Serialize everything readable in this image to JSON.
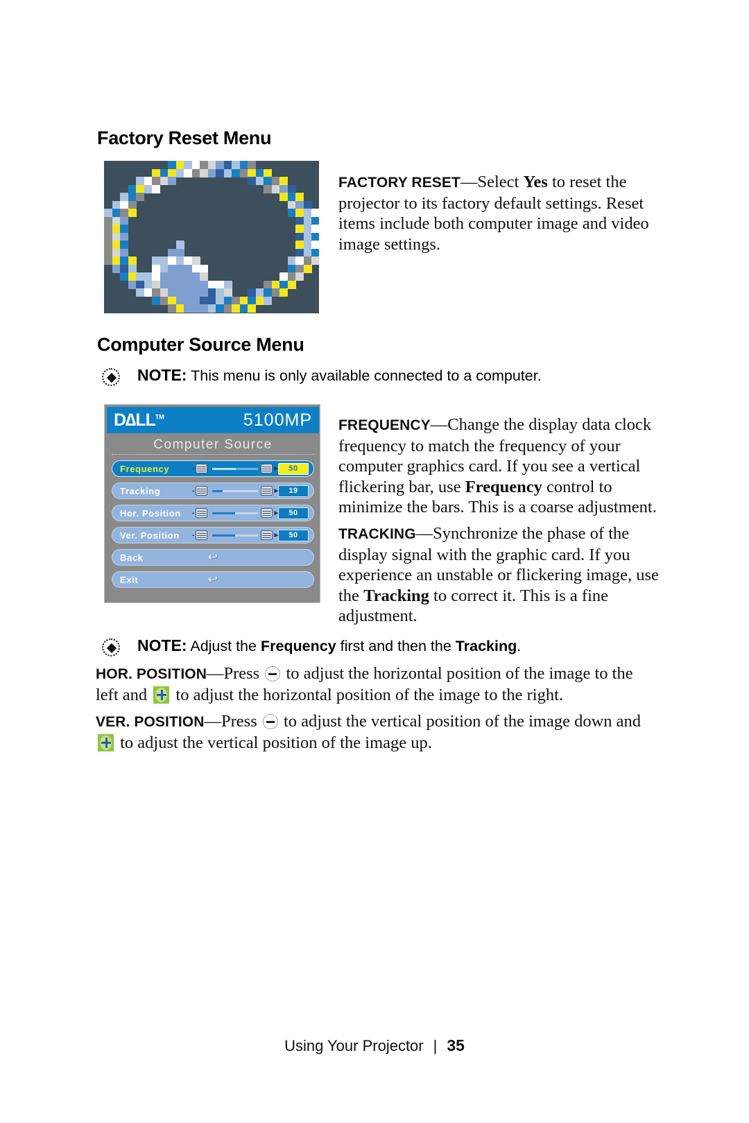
{
  "page": {
    "footer_section": "Using Your Projector",
    "footer_separator": "|",
    "page_number": "35"
  },
  "factory_reset_section": {
    "heading": "Factory Reset Menu",
    "paragraph": {
      "term": "FACTORY RESET",
      "dash": "—",
      "text_before_bold": "Select ",
      "bold_word": "Yes",
      "text_after_bold": " to reset the projector to its factory default settings. Reset items include both computer image and video image settings."
    },
    "image": {
      "name": "factory-reset-mosaic",
      "background_color": "#3d4f5c",
      "palette": [
        "#3d4f5c",
        "#1a7fc1",
        "#f2e71c",
        "#aac3e0",
        "#ffffff",
        "#8b8b8b",
        "#d6d6d6",
        "#7e9fd0",
        "#2f5f9e"
      ]
    }
  },
  "computer_source_section": {
    "heading": "Computer Source Menu",
    "note_availability": {
      "label": "NOTE:",
      "text": " This menu is only available connected to a computer."
    },
    "note_adjust_order": {
      "label": "NOTE:",
      "text_1": " Adjust the ",
      "bold_1": "Frequency",
      "text_2": " first and then the ",
      "bold_2": "Tracking",
      "text_3": "."
    },
    "paragraphs": [
      {
        "term": "FREQUENCY",
        "dash": "—",
        "text_before_bold": "Change the display data clock frequency to match the frequency of your computer graphics card. If you see a vertical flickering bar, use ",
        "bold_word": "Frequency",
        "text_after_bold": " control to minimize the bars. This is a coarse adjustment."
      },
      {
        "term": "TRACKING",
        "dash": "—",
        "text_before_bold": "Synchronize the phase of the display signal with the graphic card. If you experience an unstable or flickering image, use the ",
        "bold_word": "Tracking",
        "text_after_bold": " to correct it. This is a fine adjustment."
      }
    ],
    "hor_position": {
      "term": "HOR. POSITION",
      "dash": "—",
      "text_1": "Press ",
      "icon_1": "minus-button-icon",
      "text_2": " to adjust the horizontal position of the image to the left and ",
      "icon_2": "plus-button-icon",
      "text_3": " to adjust the horizontal position of the image to the right."
    },
    "ver_position": {
      "term": "VER. POSITION",
      "dash": "—",
      "text_1": "Press ",
      "icon_1": "minus-button-icon",
      "text_2": " to adjust the vertical position of the image down and ",
      "icon_2": "plus-button-icon",
      "text_3": " to adjust the vertical position of the image up."
    }
  },
  "osd_menu": {
    "brand": "D∆LL",
    "brand_tm": "TM",
    "model": "5100MP",
    "title": "Computer  Source",
    "header_color": "#0d7fc4",
    "selected_row_color": "#0d7fc4",
    "selected_label_color": "#e8ef33",
    "selected_value_color": "#f4ee1c",
    "row_color": "#93b4dd",
    "panel_color": "#8a8a8a",
    "rows": [
      {
        "label": "Frequency",
        "value": "50",
        "selected": true,
        "fill_percent": 52,
        "left_icon": "frequency-decrease-icon",
        "right_icon": "frequency-increase-icon"
      },
      {
        "label": "Tracking",
        "value": "19",
        "selected": false,
        "fill_percent": 22,
        "left_icon": "tracking-decrease-icon",
        "right_icon": "tracking-increase-icon"
      },
      {
        "label": "Hor. Position",
        "value": "50",
        "selected": false,
        "fill_percent": 50,
        "left_icon": "hor-position-left-icon",
        "right_icon": "hor-position-right-icon"
      },
      {
        "label": "Ver. Position",
        "value": "50",
        "selected": false,
        "fill_percent": 50,
        "left_icon": "ver-position-down-icon",
        "right_icon": "ver-position-up-icon"
      }
    ],
    "actions": [
      {
        "label": "Back",
        "icon": "return-arrow-icon"
      },
      {
        "label": "Exit",
        "icon": "return-arrow-icon"
      }
    ]
  }
}
